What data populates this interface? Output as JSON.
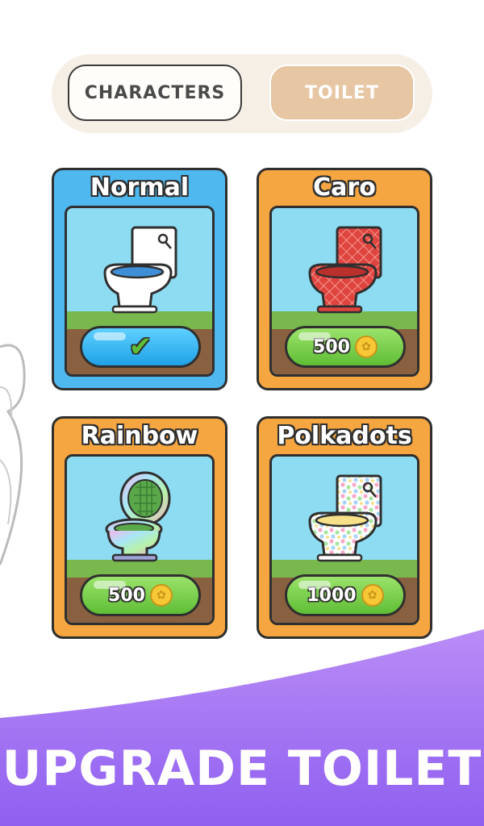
{
  "tabs": [
    {
      "label": "CHARACTERS",
      "active": false
    },
    {
      "label": "TOILET",
      "active": true
    }
  ],
  "cards": [
    {
      "name": "Normal",
      "owned": true,
      "price": null,
      "theme": "blue",
      "toilet_style": "white"
    },
    {
      "name": "Caro",
      "owned": false,
      "price": "500",
      "theme": "orange",
      "toilet_style": "red-checkered"
    },
    {
      "name": "Rainbow",
      "owned": false,
      "price": "500",
      "theme": "orange",
      "toilet_style": "rainbow"
    },
    {
      "name": "Polkadots",
      "owned": false,
      "price": "1000",
      "theme": "orange",
      "toilet_style": "polkadots"
    }
  ],
  "banner": {
    "text": "UPGRADE TOILET",
    "color": "#a274f0"
  },
  "icons": {
    "coin": "coin-icon",
    "owned": "checkmark-icon"
  },
  "colors": {
    "card_blue": "#4fb8ef",
    "card_orange": "#f6a640",
    "button_green": "#6ccb3f",
    "button_blue": "#2aa9ec"
  }
}
